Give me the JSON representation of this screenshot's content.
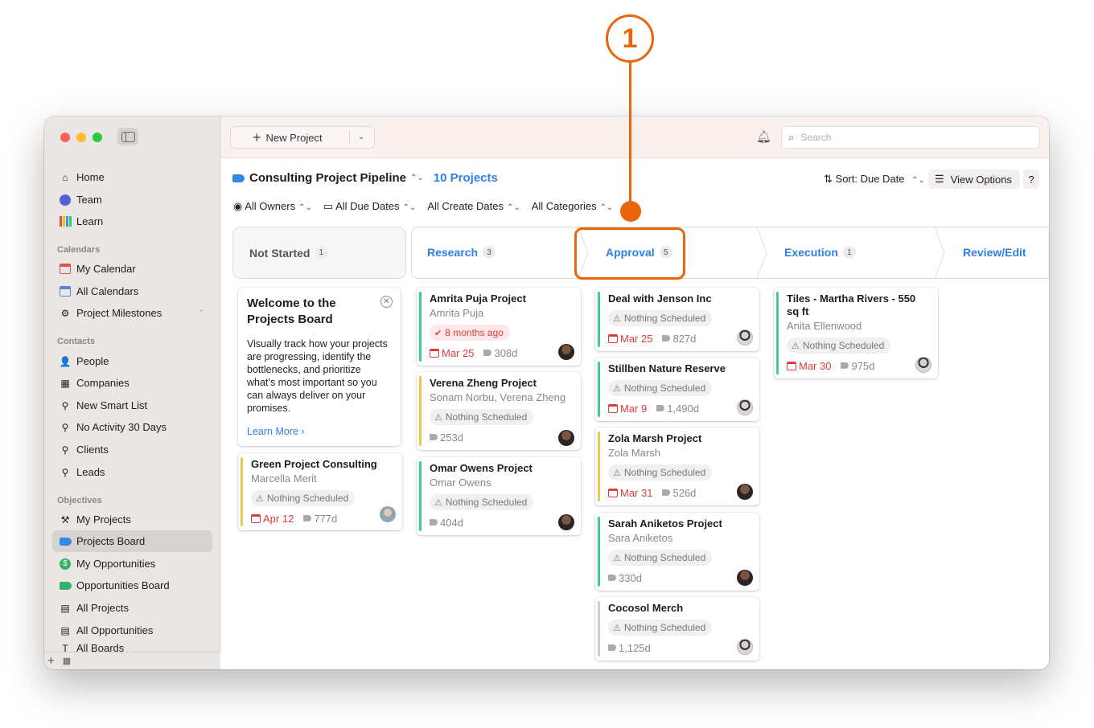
{
  "callout": {
    "number": "1"
  },
  "sidebar": {
    "top": [
      {
        "label": "Home",
        "icon": "home-icon"
      },
      {
        "label": "Team",
        "icon": "team-icon"
      },
      {
        "label": "Learn",
        "icon": "learn-icon"
      }
    ],
    "calendars_title": "Calendars",
    "calendars": [
      {
        "label": "My Calendar"
      },
      {
        "label": "All Calendars"
      },
      {
        "label": "Project Milestones"
      }
    ],
    "contacts_title": "Contacts",
    "contacts": [
      {
        "label": "People"
      },
      {
        "label": "Companies"
      },
      {
        "label": "New Smart List"
      },
      {
        "label": "No Activity 30 Days"
      },
      {
        "label": "Clients"
      },
      {
        "label": "Leads"
      }
    ],
    "objectives_title": "Objectives",
    "objectives": [
      {
        "label": "My Projects"
      },
      {
        "label": "Projects Board"
      },
      {
        "label": "My Opportunities"
      },
      {
        "label": "Opportunities Board"
      },
      {
        "label": "All Projects"
      },
      {
        "label": "All Opportunities"
      },
      {
        "label": "All Boards"
      }
    ]
  },
  "toolbar": {
    "new_project": "New Project",
    "search_placeholder": "Search"
  },
  "header": {
    "title": "Consulting Project Pipeline",
    "count": "10 Projects",
    "sort": "Sort: Due Date",
    "view_options": "View Options",
    "help": "?"
  },
  "filters": [
    "All Owners",
    "All Due Dates",
    "All Create Dates",
    "All Categories"
  ],
  "stages": [
    {
      "name": "Not Started",
      "count": "1"
    },
    {
      "name": "Research",
      "count": "3"
    },
    {
      "name": "Approval",
      "count": "5"
    },
    {
      "name": "Execution",
      "count": "1"
    },
    {
      "name": "Review/Edit",
      "count": ""
    }
  ],
  "welcome": {
    "title": "Welcome to the Projects Board",
    "body": "Visually track how your projects are progressing, identify the bottlenecks, and prioritize what’s most important so you can always deliver on your promises.",
    "link": "Learn More"
  },
  "cards": {
    "not_started": [
      {
        "title": "Green Project Consulting",
        "person": "Marcella Merit",
        "pill": "Nothing Scheduled",
        "due": "Apr 12",
        "age": "777d"
      }
    ],
    "research": [
      {
        "title": "Amrita Puja Project",
        "person": "Amrita Puja",
        "pill": "8 months ago",
        "due": "Mar 25",
        "age": "308d"
      },
      {
        "title": "Verena Zheng Project",
        "person": "Sonam Norbu, Verena Zheng",
        "pill": "Nothing Scheduled",
        "due": "",
        "age": "253d"
      },
      {
        "title": "Omar Owens Project",
        "person": "Omar Owens",
        "pill": "Nothing Scheduled",
        "due": "",
        "age": "404d"
      }
    ],
    "approval": [
      {
        "title": "Deal with Jenson Inc",
        "person": "",
        "pill": "Nothing Scheduled",
        "due": "Mar 25",
        "age": "827d"
      },
      {
        "title": "Stillben Nature Reserve",
        "person": "",
        "pill": "Nothing Scheduled",
        "due": "Mar 9",
        "age": "1,490d"
      },
      {
        "title": "Zola Marsh Project",
        "person": "Zola Marsh",
        "pill": "Nothing Scheduled",
        "due": "Mar 31",
        "age": "526d"
      },
      {
        "title": "Sarah Aniketos Project",
        "person": "Sara Aniketos",
        "pill": "Nothing Scheduled",
        "due": "",
        "age": "330d"
      },
      {
        "title": "Cocosol Merch",
        "person": "",
        "pill": "Nothing Scheduled",
        "due": "",
        "age": "1,125d"
      }
    ],
    "execution": [
      {
        "title": "Tiles - Martha Rivers - 550 sq ft",
        "person": "Anita Ellenwood",
        "pill": "Nothing Scheduled",
        "due": "Mar 30",
        "age": "975d"
      }
    ]
  },
  "colors": {
    "accent": "#2f7fe8",
    "callout": "#e8650c",
    "due": "#e03b3b",
    "green": "#3dcf8e",
    "yellow": "#ecc94b",
    "gray": "#cccccc"
  }
}
